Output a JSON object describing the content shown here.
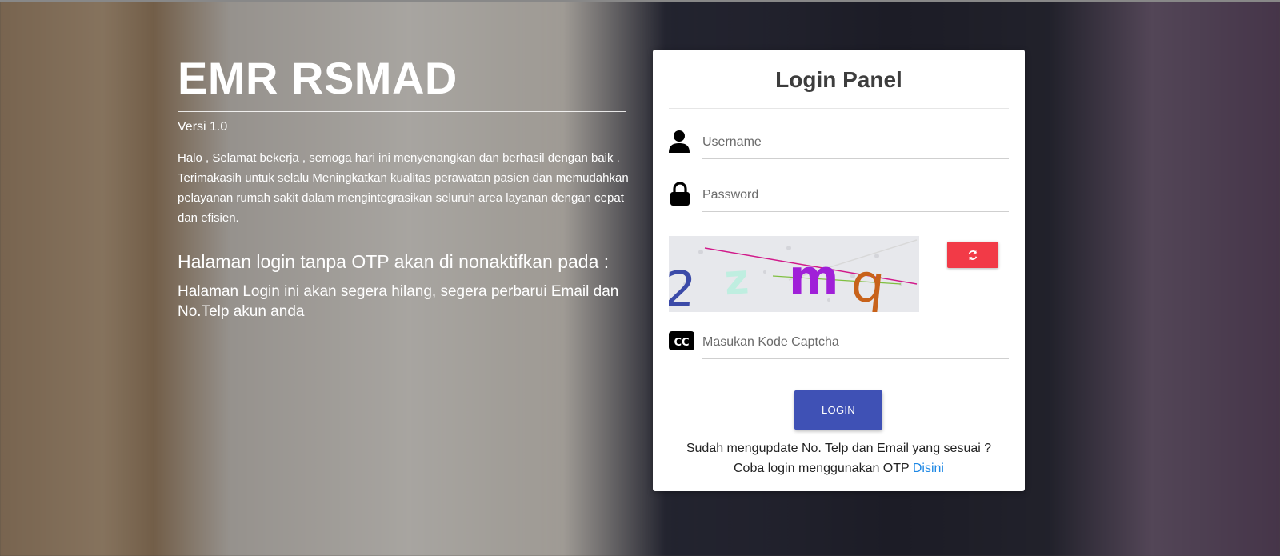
{
  "intro": {
    "title": "EMR RSMAD",
    "version": "Versi 1.0",
    "greeting": "Halo , Selamat bekerja , semoga hari ini menyenangkan dan berhasil dengan baik . Terimakasih untuk selalu Meningkatkan kualitas perawatan pasien dan memudahkan pelayanan rumah sakit dalam mengintegrasikan seluruh area layanan dengan cepat dan efisien.",
    "otp_title": "Halaman login tanpa OTP akan di nonaktifkan pada :",
    "otp_note": "Halaman Login ini akan segera hilang, segera perbarui Email dan No.Telp akun anda"
  },
  "login": {
    "title": "Login Panel",
    "username_placeholder": "Username",
    "password_placeholder": "Password",
    "captcha_placeholder": "Masukan Kode Captcha",
    "captcha_text": "2 z m q",
    "button_label": "LOGIN",
    "otp_line1": "Sudah mengupdate No. Telp dan Email yang sesuai ?",
    "otp_line2": "Coba login menggunakan OTP",
    "otp_link": "Disini"
  },
  "icons": {
    "username": "person-icon",
    "password": "lock-icon",
    "captcha": "closed-caption-icon",
    "refresh": "refresh-icon"
  },
  "colors": {
    "primary": "#3f51b5",
    "refresh": "#f23a47",
    "link": "#1e88e5"
  }
}
